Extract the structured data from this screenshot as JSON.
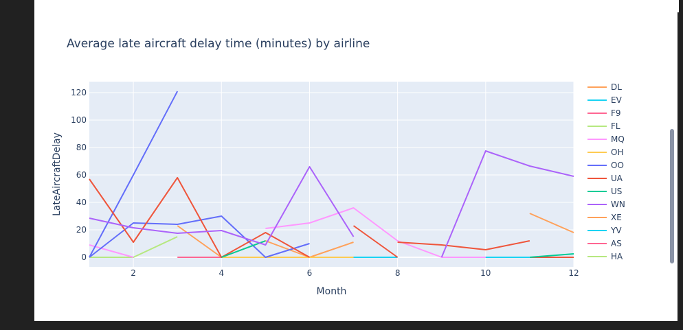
{
  "chart_data": {
    "type": "line",
    "title": "Average late aircraft delay time (minutes) by airline",
    "xlabel": "Month",
    "ylabel": "LateAircraftDelay",
    "xlim": [
      1,
      12
    ],
    "ylim": [
      -7,
      128
    ],
    "xticks": [
      2,
      4,
      6,
      8,
      10,
      12
    ],
    "yticks": [
      0,
      20,
      40,
      60,
      80,
      100,
      120
    ],
    "grid": true,
    "legend_position": "right",
    "series": [
      {
        "name": "DL",
        "color": "#FFA15A",
        "x": [
          3,
          4,
          5,
          6,
          7,
          null,
          11,
          12
        ],
        "y": [
          23,
          0,
          12,
          0,
          11,
          null,
          32,
          18
        ]
      },
      {
        "name": "EV",
        "color": "#19D3F3",
        "x": [
          7,
          8
        ],
        "y": [
          0,
          0
        ]
      },
      {
        "name": "F9",
        "color": "#FF6692",
        "x": [
          3,
          4
        ],
        "y": [
          0,
          0
        ]
      },
      {
        "name": "FL",
        "color": "#B6E880",
        "x": [
          1,
          2,
          3
        ],
        "y": [
          0,
          0,
          15
        ]
      },
      {
        "name": "MQ",
        "color": "#FF97FF",
        "x": [
          1,
          2,
          null,
          5,
          6,
          7,
          8,
          9,
          10,
          11
        ],
        "y": [
          9,
          0,
          null,
          21,
          25,
          36,
          12,
          0,
          0,
          0
        ]
      },
      {
        "name": "OH",
        "color": "#FECB52",
        "x": [
          4,
          5,
          6,
          7
        ],
        "y": [
          0,
          0,
          0,
          0
        ]
      },
      {
        "name": "OO",
        "color": "#636EFA",
        "x": [
          1,
          2,
          3,
          null,
          1,
          2,
          3,
          4,
          5,
          6
        ],
        "y": [
          0,
          60,
          121,
          null,
          0,
          25,
          24,
          30,
          0,
          10
        ]
      },
      {
        "name": "UA",
        "color": "#EF553B",
        "x": [
          1,
          2,
          3,
          4,
          5,
          6,
          null,
          7,
          8,
          null,
          8,
          9,
          10,
          11,
          null,
          11,
          12
        ],
        "y": [
          57,
          11,
          58,
          0,
          18,
          0,
          null,
          23,
          0,
          null,
          11,
          9,
          5.5,
          12,
          null,
          0,
          0
        ]
      },
      {
        "name": "US",
        "color": "#00CC96",
        "x": [
          4,
          5,
          null,
          11,
          12
        ],
        "y": [
          0,
          12,
          null,
          0,
          2.5
        ]
      },
      {
        "name": "WN",
        "color": "#AB63FA",
        "x": [
          1,
          2,
          3,
          4,
          5,
          6,
          7,
          null,
          9,
          10,
          11,
          12
        ],
        "y": [
          28.5,
          21.5,
          17.5,
          19.5,
          9,
          66,
          15,
          null,
          0,
          77.5,
          66.5,
          59
        ]
      },
      {
        "name": "XE",
        "color": "#FFA15A",
        "x": [],
        "y": []
      },
      {
        "name": "YV",
        "color": "#19D3F3",
        "x": [
          10,
          11
        ],
        "y": [
          0,
          0
        ]
      },
      {
        "name": "AS",
        "color": "#FF6692",
        "x": [],
        "y": []
      },
      {
        "name": "HA",
        "color": "#B6E880",
        "x": [],
        "y": []
      }
    ]
  }
}
